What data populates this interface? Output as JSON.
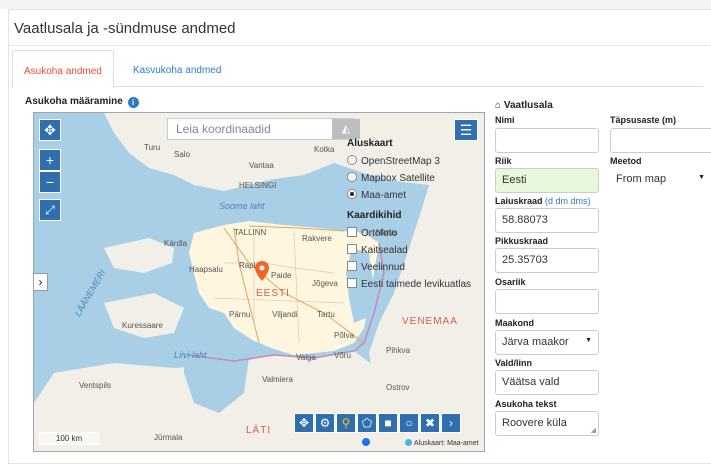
{
  "panel": {
    "title": "Vaatlusala ja -sündmuse andmed"
  },
  "tabs": [
    {
      "label": "Asukoha andmed",
      "active": true
    },
    {
      "label": "Kasvukoha andmed",
      "active": false
    }
  ],
  "map_section": {
    "label": "Asukoha määramine",
    "info_icon": "info-circle-icon"
  },
  "map": {
    "search_placeholder": "Leia koordinaadid",
    "layers_title": "Aluskaart",
    "base_layers": [
      {
        "label": "OpenStreetMap 3",
        "selected": false
      },
      {
        "label": "Mapbox Satellite",
        "selected": false
      },
      {
        "label": "Maa-amet",
        "selected": true
      }
    ],
    "overlays_title": "Kaardikihid",
    "overlays": [
      {
        "label": "Ortofoto",
        "checked": false
      },
      {
        "label": "Kaitsealad",
        "checked": false
      },
      {
        "label": "Veelinnud",
        "checked": false
      },
      {
        "label": "Eesti taimede levikuatlas",
        "checked": false
      }
    ],
    "places": {
      "turu": "Turu",
      "salo": "Salo",
      "kotka": "Kotka",
      "vantaa": "Vantaa",
      "helsingi": "HELSINGI",
      "soome_laht": "Soome laht",
      "tallinn": "TALLINN",
      "rakvere": "Rakvere",
      "narva": "Narva",
      "laanemeri": "LÄÄNEMERI",
      "kardla": "Kärdla",
      "haapsalu": "Haapsalu",
      "rapla": "Rapla",
      "paide": "Paide",
      "jogeva": "Jõgeva",
      "eesti": "EESTI",
      "parnu": "Pärnu",
      "viljandi": "Viljandi",
      "tartu": "Tartu",
      "kuressaare": "Kuressaare",
      "venemaa": "VENEMAA",
      "polva": "Põlva",
      "liivi_laht": "Liivi laht",
      "valga": "Valga",
      "voru": "Võru",
      "pihkva": "Pihkva",
      "ventspils": "Ventspils",
      "ostrov": "Ostrov",
      "valmiera": "Valmiera",
      "latvia": "LÄTI",
      "jurmala": "Jūrmala"
    },
    "scale_label": "100 km",
    "attribution": "Aluskaart: Maa-amet",
    "tools": [
      "move-icon",
      "gear-icon",
      "marker-icon",
      "polygon-icon",
      "square-icon",
      "circle-icon",
      "close-icon",
      "chevron-right-icon"
    ]
  },
  "form": {
    "heading": "Vaatlusala",
    "nimi": {
      "label": "Nimi",
      "value": ""
    },
    "tapsusaste": {
      "label": "Täpsusaste (m)",
      "value": ""
    },
    "riik": {
      "label": "Riik",
      "value": "Eesti"
    },
    "meetod": {
      "label": "Meetod",
      "value": "From map"
    },
    "laiuskraad": {
      "label": "Laiuskraad",
      "hint": "(d dm dms)",
      "value": "58.88073"
    },
    "pikkuskraad": {
      "label": "Pikkuskraad",
      "value": "25.35703"
    },
    "osariik": {
      "label": "Osariik",
      "value": ""
    },
    "maakond": {
      "label": "Maakond",
      "value": "Järva maakor"
    },
    "vald": {
      "label": "Vald/linn",
      "value": "Väätsa vald"
    },
    "asukoha_tekst": {
      "label": "Asukoha tekst",
      "value": "Roovere küla"
    }
  }
}
